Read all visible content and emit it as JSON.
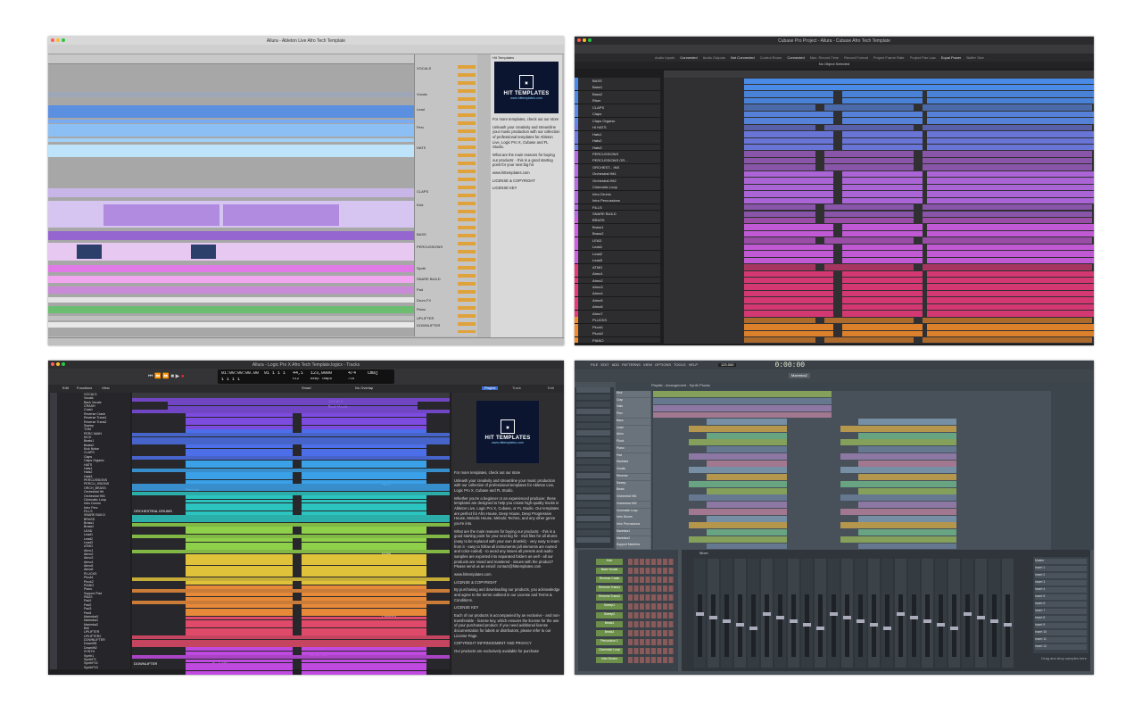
{
  "ableton": {
    "title": "Allura - Ableton Live Afro Tech Template",
    "browser_header": "Hit Templates",
    "logo_text": "HIT TEMPLATES",
    "logo_sub": "www.hittemplates.com",
    "paragraphs": [
      "For more templates, check out our store",
      "Unleash your creativity and streamline your music production with our collection of professional templates for Ableton Live, Logic Pro X, Cubase and FL Studio.",
      "What are the main reasons for buying our products: - this is a good starting point for your next big hit",
      "www.hittemplates.com",
      "LICENSE & COPYRIGHT",
      "LICENSE KEY"
    ],
    "tracks": [
      "VOCALS",
      "Vocals",
      "Lead",
      "Perc",
      "HATS",
      "CLAPS",
      "Kick",
      "BASS",
      "PERCUSSIONS",
      "Synth",
      "SNARE BUILD",
      "Pad",
      "Drum FX",
      "Piano",
      "UPLIFTER",
      "DOWNLIFTER"
    ]
  },
  "cubase": {
    "title": "Cubase Pro Project - Allura - Cubase Afro Tech Template",
    "status": "No Object Selected",
    "toolbar_items": [
      "Audio Inputs",
      "Connected",
      "Audio Outputs",
      "Not Connected",
      "Control Room",
      "Connected",
      "Max. Record Time",
      "Record Format",
      "Project Frame Rate",
      "Project Pan Law",
      "Equal Power",
      "Buffer Size"
    ],
    "tracks": [
      "BASS",
      "Bass1",
      "Bass2",
      "Riser",
      "CLAPS",
      "Claps",
      "Claps Organic",
      "HI HATS",
      "Hats1",
      "Hats2",
      "Hats3",
      "PERCUSSIONS",
      "PERCUSSIONS OR...",
      "ORCHEST... INS",
      "Orchestral Hit1",
      "Orchestral Hit2",
      "Cinematic Loop",
      "Intro Drums",
      "Intro Percussions",
      "FILLS",
      "SNARE BUILD",
      "BRASS",
      "Brass1",
      "Brass2",
      "LEAD",
      "Lead1",
      "Lead2",
      "Lead3",
      "ATMO",
      "Atmo1",
      "Atmo2",
      "Atmo3",
      "Atmo4",
      "Atmo5",
      "Atmo6",
      "Atmo7",
      "PLUCKS",
      "Pluck1",
      "Pluck2",
      "PIANO"
    ]
  },
  "logic": {
    "title": "Allura - Logic Pro X Afro Tech Template.logicx - Tracks",
    "menu": [
      "Edit",
      "Functions",
      "View"
    ],
    "lcd": {
      "time": "01:00:00:00.00",
      "bars": "91 1 1 1",
      "bars2": "1 1 1 1",
      "tempo": "123,0000",
      "tempo_label": "Keep Tempo",
      "sig": "4/4",
      "sig2": "/16",
      "key": "Cmaj",
      "cpu": "44,1",
      "cpu2": "512"
    },
    "snap": "Smart",
    "drag": "No Overlap",
    "tabs": [
      "Project",
      "Track"
    ],
    "edit_label": "Edit",
    "logo_text": "HIT TEMPLATES",
    "logo_sub": "www.hittemplates.com",
    "paragraphs": [
      "For more templates, check out our store",
      "Unleash your creativity and streamline your music production with our collection of professional templates for Ableton Live, Logic Pro X, Cubase and FL Studio.",
      "Whether you're a beginner or an experienced producer, these templates are designed to help you create high-quality tracks in Ableton Live, Logic Pro X, Cubase, or FL Studio. Our templates are perfect for Afro House, Deep House, Deep Progressive House, Melodic House, Melodic Techno, and any other genre you're into.",
      "What are the main reasons for buying our products: - this is a good starting point for your next big hit - midi files for all drums (easy to be replaced with your own drumkit) - very easy to learn from it - easy to follow all instruments (all elements are named and color-coded) - to avoid any issues all presets and audio samples are exported into separated folders as well - all our products are mixed and mastered - issues with the product? Please send us an email: contact@hittemplates.com",
      "www.hittemplates.com",
      "LICENSE & COPYRIGHT",
      "By purchasing and downloading our products, you acknowledge and agree to the terms outlined in our License and Terms & Conditions.",
      "LICENSE KEY",
      "Each of our products is accompanied by an exclusive - and non-transferable - license key, which ensures the license for the use of your purchased product. If you need additional license documentation for labels or distributors, please refer to our License Page.",
      "COPYRIGHT INFRINGEMENT AND PRIVACY",
      "Our products are exclusively available for purchase"
    ],
    "tracks": [
      "VOCALS",
      "Vocals",
      "Back Vocals",
      "CRASH",
      "Crash",
      "Reverse Crash",
      "Reverse Trans1",
      "Reverse Trans2",
      "Sweep",
      "TOM",
      "PERC MAIN",
      "KICK",
      "Beats1",
      "Beats2",
      "Kick Noise",
      "CLAPS",
      "Claps",
      "Claps Organic",
      "HATS",
      "Hats1",
      "Hats2",
      "Hats3",
      "PERCUSSIONS",
      "PERCU_SSIONS",
      "ORCH_BRASS",
      "Orchestral Hit",
      "Orchestral Hit1",
      "Cinematic Loop",
      "Intro Drums",
      "Intro Perc",
      "FILLS",
      "SNARE BUILD",
      "BRASS",
      "Brass1",
      "Brass2",
      "LEAD",
      "Lead1",
      "Lead2",
      "Lead3",
      "ATMO",
      "Atmo1",
      "Atmo2",
      "Atmo3",
      "Atmo4",
      "Atmo5",
      "Atmo6",
      "PLUCKS",
      "Pluck1",
      "Pluck2",
      "PIANO",
      "Piano",
      "Support Pad",
      "PADS",
      "Pad1",
      "Pad2",
      "Pad3",
      "Pad4",
      "MarimbaX",
      "Marimba1",
      "Marimba2",
      "Bell",
      "UPLIFTER",
      "UPLIFTER2",
      "DOWNLIFTER",
      "Downlift1",
      "Downlift2",
      "SYNTH",
      "Synth1",
      "SynthFX",
      "SynthFX2",
      "SynthFX3"
    ],
    "regions": {
      "vocals": "VOCALS",
      "back_vocals": "Back Vocals",
      "bass": "BASS",
      "claps": "Claps Or",
      "hats": "HATS",
      "perc": "Percussi",
      "orch": "ORCHESTRAL DRUMS",
      "lead": "LEAD",
      "plucks": "PLUCKS",
      "uplifter": "UPLIFTER",
      "downlifter": "DOWNLIFTER",
      "synth": "Synth1FX"
    }
  },
  "fl": {
    "menu": [
      "FILE",
      "EDIT",
      "ADD",
      "PATTERNS",
      "VIEW",
      "OPTIONS",
      "TOOLS",
      "HELP"
    ],
    "time": "0:00:00",
    "tempo": "123.000",
    "pattern": "Marimba2",
    "playlist_title": "Playlist - Arrangement - Synth Plucks",
    "mixer_title": "Mixer",
    "hint": "Drag and drop samples here",
    "channel_rack": [
      "Kick",
      "Back Vocals",
      "Reverse Crash",
      "Reverse Trans1",
      "Reverse Trans2",
      "Sweep1",
      "Sweep2",
      "Beats1",
      "Beats2",
      "Percussion 1",
      "Cinematic Loop",
      "Intro Drums"
    ],
    "tracks": [
      "Kick",
      "Clap",
      "Hats",
      "Perc",
      "Bass",
      "Lead",
      "Atmo",
      "Pluck",
      "Piano",
      "Pad",
      "Marimba",
      "Vocals",
      "Reverse",
      "Sweep",
      "Beats",
      "Orchestral Hit1",
      "Orchestral Hit2",
      "Cinematic Loop",
      "Intro Drums",
      "Intro Percussions",
      "Marimba1",
      "Marimba2",
      "Support Marimba"
    ],
    "mixer_slots": [
      "Master",
      "Insert 1",
      "Insert 2",
      "Insert 3",
      "Insert 4",
      "Insert 5",
      "Insert 6",
      "Insert 7",
      "Insert 8",
      "Insert 9",
      "Insert 10",
      "Insert 11",
      "Insert 12"
    ]
  }
}
